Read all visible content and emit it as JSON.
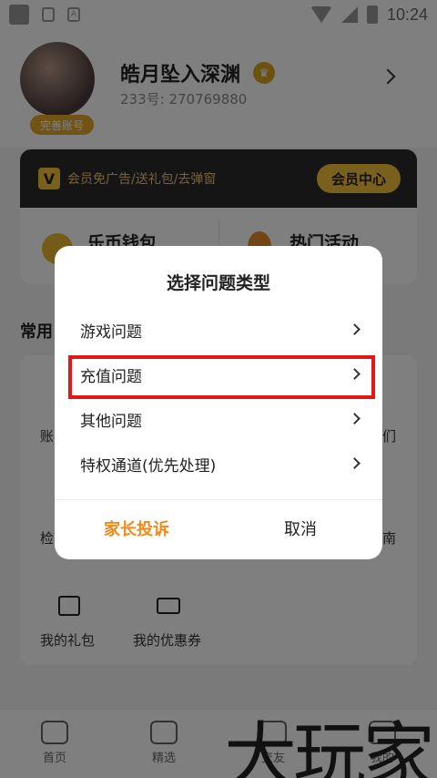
{
  "status_bar": {
    "time": "10:24"
  },
  "profile": {
    "username": "皓月坠入深渊",
    "user_id": "233号: 270769880",
    "complete_account_badge": "完善账号"
  },
  "vip": {
    "logo": "V",
    "text": "会员免广告/送礼包/去弹窗",
    "button": "会员中心"
  },
  "quick": {
    "wallet": "乐币钱包",
    "activity": "热门活动"
  },
  "common": {
    "title": "常用",
    "items": {
      "account_partial": "账",
      "check_partial": "检",
      "us_partial": "们",
      "guide_partial": "南",
      "gift": "我的礼包",
      "coupon": "我的优惠券"
    }
  },
  "bottom_nav": {
    "home": "首页",
    "featured": "精选",
    "friends_partial": "交友",
    "me_partial": "我的"
  },
  "watermark": "大玩家",
  "dialog": {
    "title": "选择问题类型",
    "options": [
      "游戏问题",
      "充值问题",
      "其他问题",
      "特权通道(优先处理)"
    ],
    "parent_complaint": "家长投诉",
    "cancel": "取消"
  },
  "colors": {
    "accent_orange": "#f08a1a",
    "highlight_red": "#e01818",
    "vip_gold": "#f3c33a"
  }
}
